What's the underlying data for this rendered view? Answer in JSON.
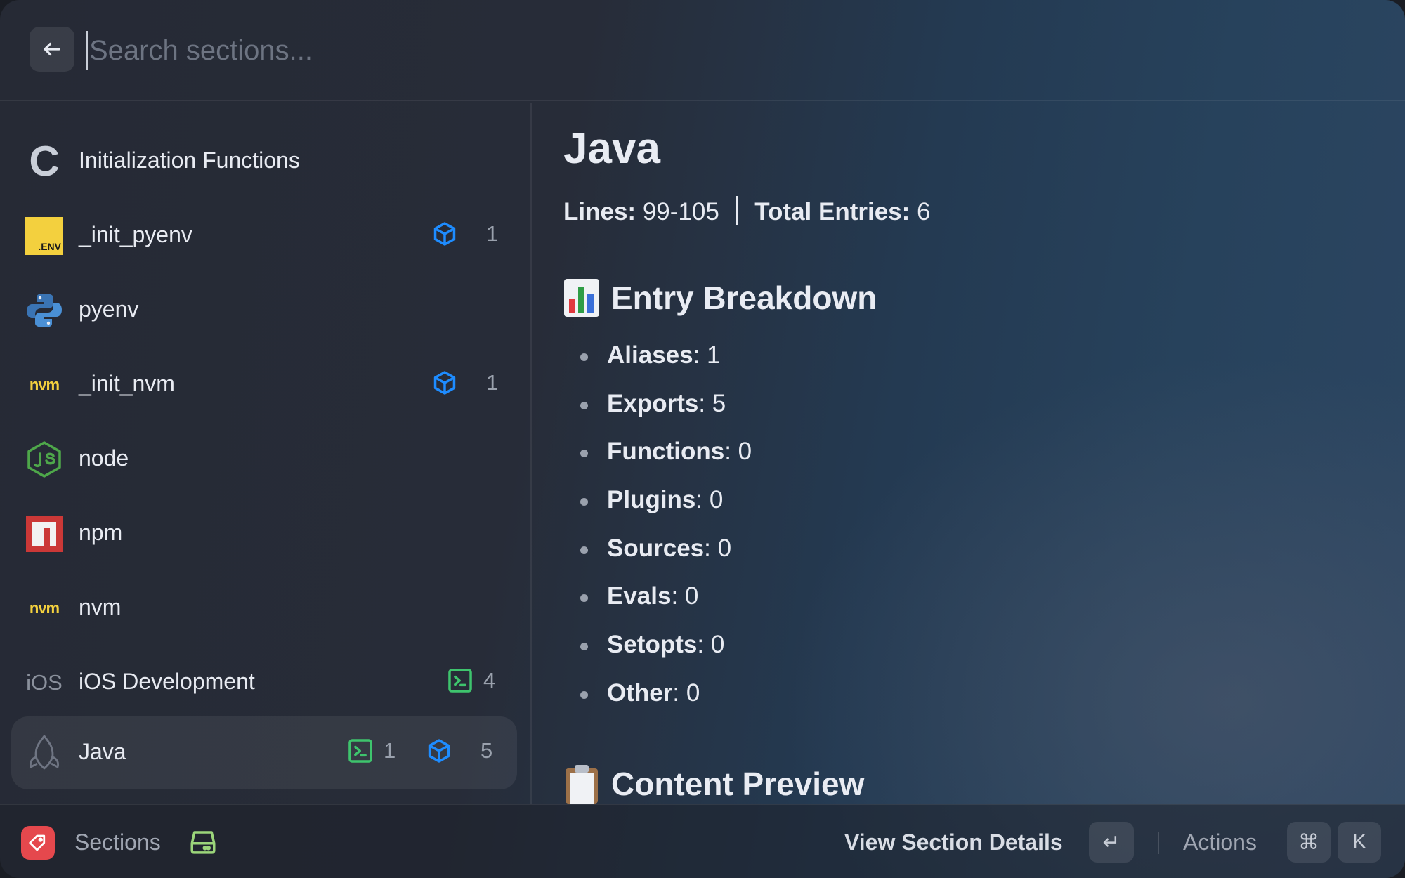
{
  "search": {
    "placeholder": "Search sections...",
    "value": ""
  },
  "sidebar": {
    "items": [
      {
        "label": "Initialization Functions",
        "icon": "c-letter-icon"
      },
      {
        "label": "_init_pyenv",
        "icon": "env-file-icon",
        "module_count": "1"
      },
      {
        "label": "pyenv",
        "icon": "python-icon"
      },
      {
        "label": "_init_nvm",
        "icon": "nvm-icon",
        "module_count": "1"
      },
      {
        "label": "node",
        "icon": "nodejs-icon"
      },
      {
        "label": "npm",
        "icon": "npm-icon"
      },
      {
        "label": "nvm",
        "icon": "nvm-icon"
      },
      {
        "label": "iOS Development",
        "icon": "ios-icon",
        "terminal_count": "4"
      },
      {
        "label": "Java",
        "icon": "java-icon",
        "terminal_count": "1",
        "module_count": "5",
        "selected": true
      }
    ],
    "icon_text": {
      "c_letter": "C",
      "env": ".ENV",
      "nvm": "nvm",
      "ios": "iOS"
    }
  },
  "detail": {
    "title": "Java",
    "lines_label": "Lines:",
    "lines_value": "99-105",
    "total_label": "Total Entries:",
    "total_value": "6",
    "breakdown_heading": "Entry Breakdown",
    "breakdown": [
      {
        "key": "Aliases",
        "value": "1"
      },
      {
        "key": "Exports",
        "value": "5"
      },
      {
        "key": "Functions",
        "value": "0"
      },
      {
        "key": "Plugins",
        "value": "0"
      },
      {
        "key": "Sources",
        "value": "0"
      },
      {
        "key": "Evals",
        "value": "0"
      },
      {
        "key": "Setopts",
        "value": "0"
      },
      {
        "key": "Other",
        "value": "0"
      }
    ],
    "preview_heading": "Content Preview"
  },
  "footer": {
    "nav_title": "Sections",
    "primary_action": "View Section Details",
    "enter_key": "↵",
    "actions_label": "Actions",
    "cmd_key": "⌘",
    "k_key": "K"
  },
  "colors": {
    "module_icon": "#1e8cff",
    "terminal_icon": "#3ec46d",
    "nvm_yellow": "#f3d03e",
    "npm_red": "#cb3837",
    "accent_red": "#e5484d"
  }
}
